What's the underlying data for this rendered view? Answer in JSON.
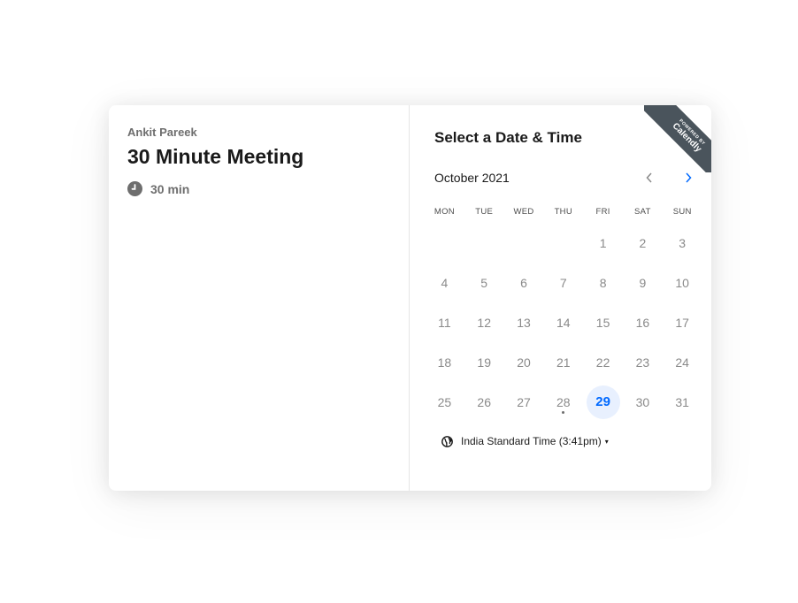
{
  "event": {
    "host_name": "Ankit Pareek",
    "title": "30 Minute Meeting",
    "duration": "30 min",
    "duration_icon": "clock-icon"
  },
  "scheduler": {
    "title": "Select a Date & Time",
    "month_label": "October 2021",
    "prev_icon": "chevron-left-icon",
    "next_icon": "chevron-right-icon",
    "weekdays": [
      "MON",
      "TUE",
      "WED",
      "THU",
      "FRI",
      "SAT",
      "SUN"
    ],
    "days": [
      "",
      "",
      "",
      "",
      "1",
      "2",
      "3",
      "4",
      "5",
      "6",
      "7",
      "8",
      "9",
      "10",
      "11",
      "12",
      "13",
      "14",
      "15",
      "16",
      "17",
      "18",
      "19",
      "20",
      "21",
      "22",
      "23",
      "24",
      "25",
      "26",
      "27",
      "28",
      "29",
      "30",
      "31"
    ],
    "today": "28",
    "selected": "29",
    "timezone_label": "India Standard Time (3:41pm)",
    "timezone_icon": "globe-icon"
  },
  "badge": {
    "small_text": "POWERED BY",
    "brand_text": "Calendly"
  },
  "colors": {
    "accent": "#0069ff",
    "selected_bg": "#e8f0fe",
    "ribbon": "#4a545c"
  }
}
